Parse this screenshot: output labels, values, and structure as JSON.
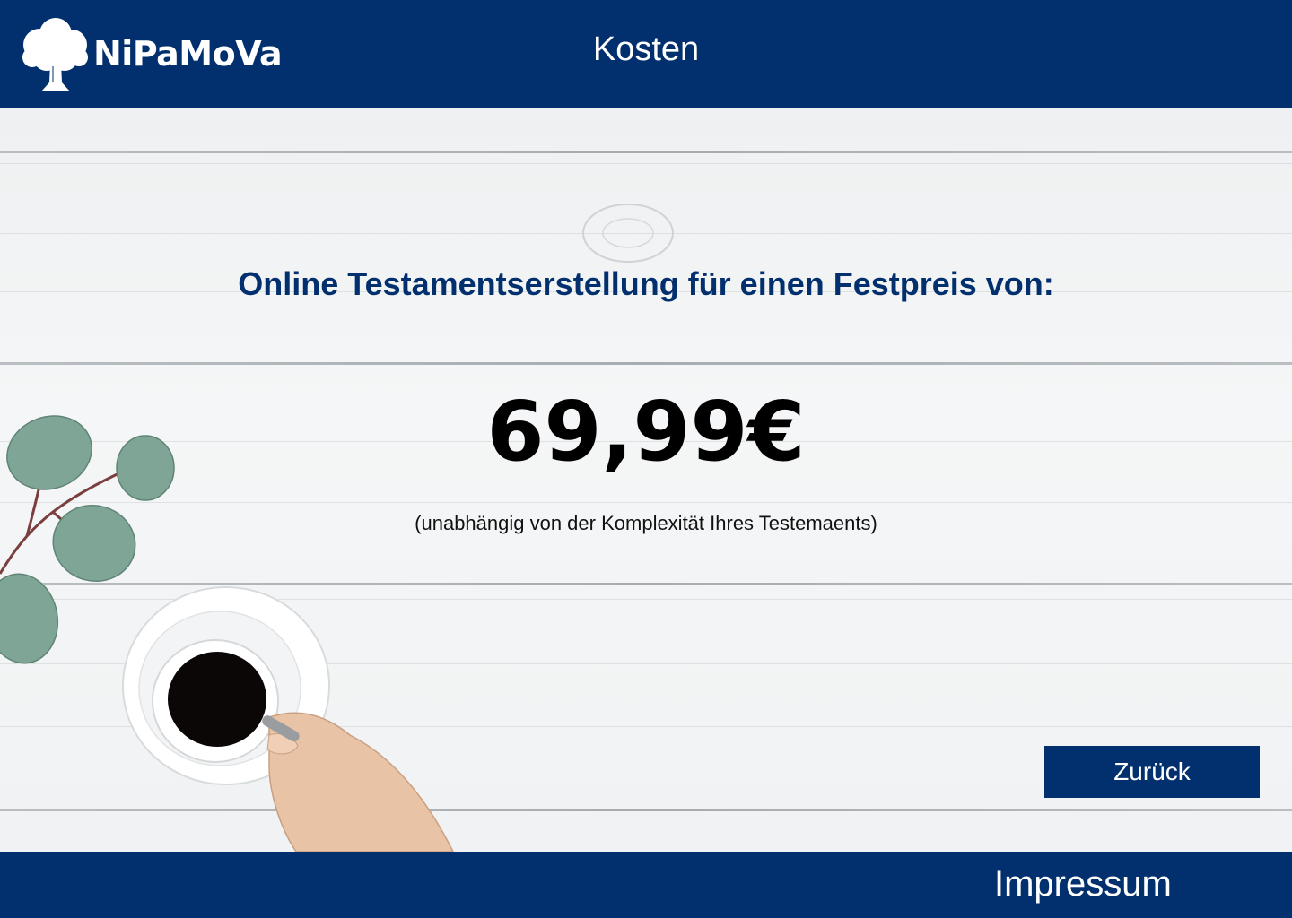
{
  "header": {
    "brand": "NiPaMoVa",
    "title": "Kosten"
  },
  "main": {
    "headline": "Online Testamentserstellung für einen Festpreis von:",
    "price": "69,99€",
    "note": "(unabhängig von der Komplexität Ihres Testemaents)",
    "back_label": "Zurück"
  },
  "footer": {
    "impressum_label": "Impressum"
  },
  "colors": {
    "brand_navy": "#02306e",
    "headline_text": "#02306e",
    "price_text": "#000000"
  },
  "icons": [
    "tree-logo-icon"
  ]
}
